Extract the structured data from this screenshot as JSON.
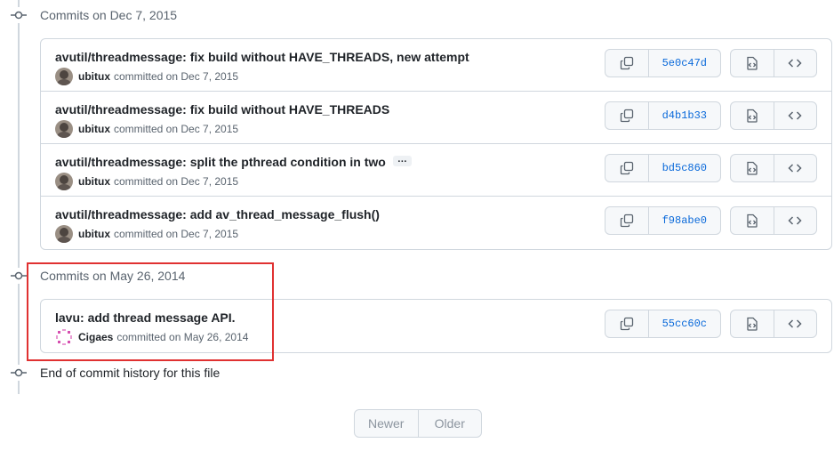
{
  "groups": [
    {
      "title": "Commits on Dec 7, 2015",
      "commits": [
        {
          "title": "avutil/threadmessage: fix build without HAVE_THREADS, new attempt",
          "author": "ubitux",
          "meta": "committed on Dec 7, 2015",
          "sha": "5e0c47d",
          "has_ellipsis": false
        },
        {
          "title": "avutil/threadmessage: fix build without HAVE_THREADS",
          "author": "ubitux",
          "meta": "committed on Dec 7, 2015",
          "sha": "d4b1b33",
          "has_ellipsis": false
        },
        {
          "title": "avutil/threadmessage: split the pthread condition in two",
          "author": "ubitux",
          "meta": "committed on Dec 7, 2015",
          "sha": "bd5c860",
          "has_ellipsis": true,
          "ellipsis": "…"
        },
        {
          "title": "avutil/threadmessage: add av_thread_message_flush()",
          "author": "ubitux",
          "meta": "committed on Dec 7, 2015",
          "sha": "f98abe0",
          "has_ellipsis": false
        }
      ]
    },
    {
      "title": "Commits on May 26, 2014",
      "commits": [
        {
          "title": "lavu: add thread message API.",
          "author": "Cigaes",
          "meta": "committed on May 26, 2014",
          "sha": "55cc60c",
          "has_ellipsis": false
        }
      ]
    }
  ],
  "end_text": "End of commit history for this file",
  "pagination": {
    "newer": "Newer",
    "older": "Older"
  },
  "icons": {
    "timeline": "git-commit-icon",
    "copy": "copy-icon",
    "browse": "file-code-icon",
    "code": "code-icon"
  },
  "colors": {
    "sha": "#0969da",
    "border": "#d0d7de",
    "highlight": "#e03131",
    "muted": "#59636e"
  }
}
